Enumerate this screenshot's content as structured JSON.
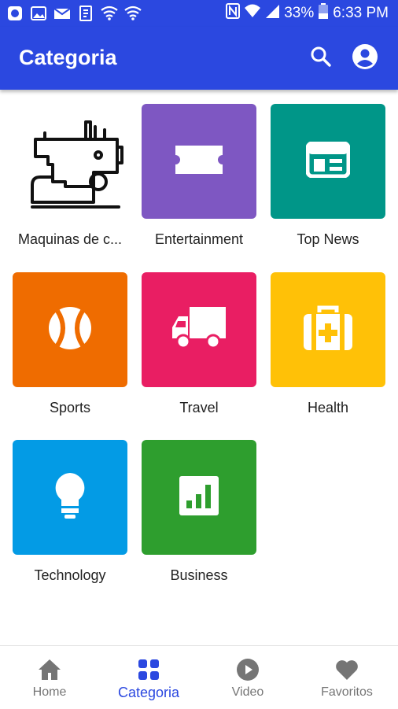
{
  "status_bar": {
    "battery": "33%",
    "time": "6:33 PM"
  },
  "app_bar": {
    "title": "Categoria",
    "search_icon": "search-icon",
    "account_icon": "account-circle-icon"
  },
  "categories": [
    {
      "label": "Maquinas de c...",
      "icon": "sewing-machine-icon",
      "color": "#ffffff"
    },
    {
      "label": "Entertainment",
      "icon": "ticket-icon",
      "color": "#7e57c2"
    },
    {
      "label": "Top News",
      "icon": "newspaper-icon",
      "color": "#009688"
    },
    {
      "label": "Sports",
      "icon": "baseball-icon",
      "color": "#ef6c00"
    },
    {
      "label": "Travel",
      "icon": "truck-icon",
      "color": "#e91e63"
    },
    {
      "label": "Health",
      "icon": "medical-bag-icon",
      "color": "#ffc107"
    },
    {
      "label": "Technology",
      "icon": "lightbulb-icon",
      "color": "#039be5"
    },
    {
      "label": "Business",
      "icon": "chart-icon",
      "color": "#2e9e2e"
    }
  ],
  "bottom_nav": [
    {
      "label": "Home",
      "icon": "home-icon",
      "active": false
    },
    {
      "label": "Categoria",
      "icon": "grid-icon",
      "active": true
    },
    {
      "label": "Video",
      "icon": "play-circle-icon",
      "active": false
    },
    {
      "label": "Favoritos",
      "icon": "heart-icon",
      "active": false
    }
  ],
  "colors": {
    "primary": "#2b48e0",
    "nav_inactive": "#757575",
    "text": "#222222"
  }
}
